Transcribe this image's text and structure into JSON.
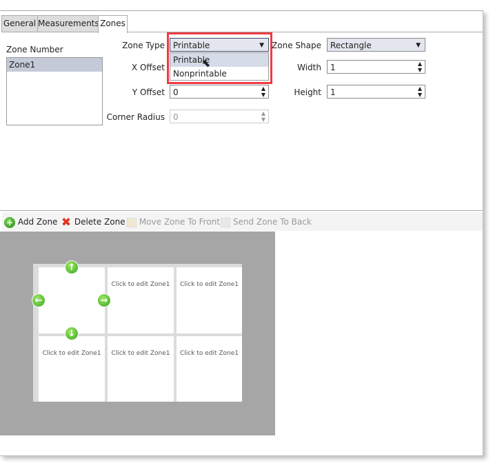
{
  "tabs": [
    {
      "label": "General"
    },
    {
      "label": "Measurements"
    },
    {
      "label": "Zones",
      "selected": true
    }
  ],
  "zone_list": {
    "label": "Zone Number",
    "items": [
      "Zone1"
    ],
    "selected": "Zone1"
  },
  "form": {
    "zone_type": {
      "label": "Zone Type",
      "value": "Printable",
      "options": [
        "Printable",
        "Nonprintable"
      ],
      "highlighted": "Printable"
    },
    "x_offset": {
      "label": "X Offset"
    },
    "y_offset": {
      "label": "Y Offset",
      "value": "0"
    },
    "corner_radius": {
      "label": "Corner Radius",
      "value": "0",
      "disabled": true
    },
    "zone_shape": {
      "label": "Zone Shape",
      "value": "Rectangle"
    },
    "width": {
      "label": "Width",
      "value": "1"
    },
    "height": {
      "label": "Height",
      "value": "1"
    }
  },
  "toolbar": {
    "add": "Add Zone",
    "delete": "Delete Zone",
    "front": "Move Zone To Front",
    "back": "Send Zone To Back"
  },
  "zones": {
    "cell_text": "Click to edit Zone1",
    "rows": 2,
    "cols": 3
  },
  "colors": {
    "highlight": "#ee3a44",
    "selection": "#c5cad8",
    "canvas": "#a6a6a6",
    "handle": "#4cbb26"
  }
}
